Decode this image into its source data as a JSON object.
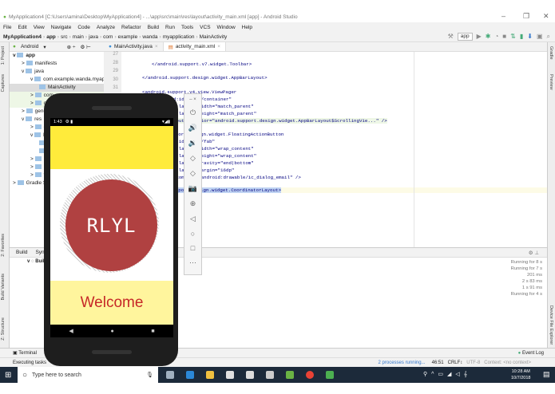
{
  "window": {
    "title": "MyApplication4 [C:\\Users\\amina\\Desktop\\MyApplication4] - ...\\app\\src\\main\\res\\layout\\activity_main.xml [app] - Android Studio"
  },
  "menu": [
    "File",
    "Edit",
    "View",
    "Navigate",
    "Code",
    "Analyze",
    "Refactor",
    "Build",
    "Run",
    "Tools",
    "VCS",
    "Window",
    "Help"
  ],
  "breadcrumb": [
    "MyApplication4",
    "app",
    "src",
    "main",
    "java",
    "com",
    "example",
    "wanda",
    "myapplication",
    "MainActivity"
  ],
  "run_config": "app",
  "project": {
    "view": "Android",
    "items": [
      {
        "label": "app",
        "depth": 0,
        "exp": "v"
      },
      {
        "label": "manifests",
        "depth": 1,
        "exp": ">"
      },
      {
        "label": "java",
        "depth": 1,
        "exp": "v"
      },
      {
        "label": "com.example.wanda.myapplic",
        "depth": 2,
        "exp": "v"
      },
      {
        "label": "MainActivity",
        "depth": 3,
        "exp": ""
      },
      {
        "label": "com",
        "depth": 2,
        "exp": ">"
      },
      {
        "label": "co",
        "depth": 2,
        "exp": ">"
      },
      {
        "label": "generatedJava",
        "depth": 1,
        "exp": ">"
      },
      {
        "label": "res",
        "depth": 1,
        "exp": "v"
      },
      {
        "label": "d",
        "depth": 2,
        "exp": ">"
      },
      {
        "label": "la",
        "depth": 2,
        "exp": "v"
      },
      {
        "label": "",
        "depth": 3,
        "exp": ""
      },
      {
        "label": "",
        "depth": 3,
        "exp": ""
      },
      {
        "label": "m",
        "depth": 2,
        "exp": ">"
      },
      {
        "label": "m",
        "depth": 2,
        "exp": ">"
      },
      {
        "label": "va",
        "depth": 2,
        "exp": ">"
      },
      {
        "label": "Gradle Scripts",
        "depth": 0,
        "exp": ">"
      }
    ]
  },
  "tabs": [
    "MainActivity.java",
    "activity_main.xml"
  ],
  "line_numbers": [
    "27",
    "28",
    "29",
    "30",
    "31"
  ],
  "code": [
    "</android.support.v7.widget.Toolbar>",
    "</android.support.design.widget.AppBarLayout>",
    "<android.support.v4.view.ViewPager",
    "android:id=\"@+id/container\"",
    "android:layout_width=\"match_parent\"",
    "android:layout_height=\"match_parent\"",
    "app:layout_behavior=\"android.support.design.widget.AppBarLayout$ScrollingVie...\" />",
    "<android.support.design.widget.FloatingActionButton",
    "android:id=\"@+id/fab\"",
    "android:layout_width=\"wrap_content\"",
    "android:layout_height=\"wrap_content\"",
    "android:layout_gravity=\"end|bottom\"",
    "android:layout_margin=\"16dp\"",
    "app:srcCompat=\"@android:drawable/ic_dialog_email\" />",
    "</android.support.design.widget.CoordinatorLayout>"
  ],
  "left_strip": [
    "1: Project",
    "Captures",
    "2: Favorites",
    "Build Variants",
    "Z: Structure"
  ],
  "right_strip": [
    "Gradle",
    "Preview",
    "Device File Explorer"
  ],
  "build": {
    "tabs": [
      "Build",
      "Sync"
    ],
    "root": "Build",
    "times": [
      "Running for 8 s",
      "Running for 7 s",
      "201 ms",
      "2 s 83 ms",
      "1 s 91 ms",
      "Running for 4 s"
    ]
  },
  "terminal_label": "Terminal",
  "event_log": "Event Log",
  "status": {
    "left": "Executing tasks",
    "processes": "2 processes running...",
    "position": "46:51",
    "line_sep": "CRLF↕",
    "encoding": "UTF-8",
    "context": "Context: <no context>"
  },
  "phone": {
    "time": "1:43",
    "logo_text": "RLYL",
    "welcome": "Welcome",
    "colors": {
      "top": "#ffeb3b",
      "circle": "#b04141",
      "bottom": "#fff59d",
      "welcome": "#c62828"
    }
  },
  "taskbar": {
    "search_placeholder": "Type here to search",
    "time": "10:28 AM",
    "date": "10/7/2018"
  }
}
